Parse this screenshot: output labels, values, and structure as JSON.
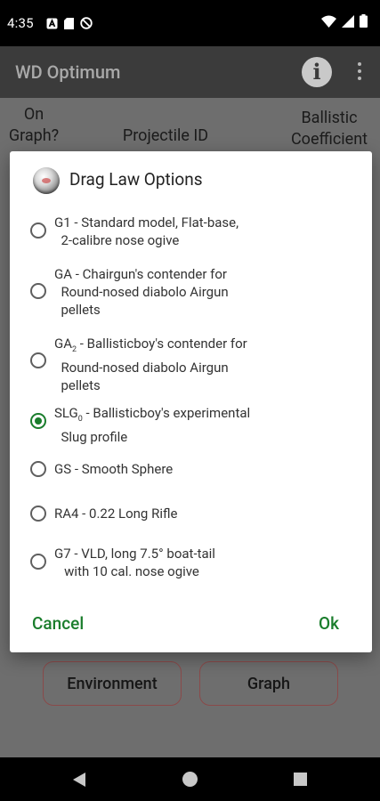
{
  "status_bar": {
    "time": "4:35"
  },
  "app_bar": {
    "title": "WD Optimum"
  },
  "background": {
    "col_on_graph_line1": "On",
    "col_on_graph_line2": "Graph?",
    "col_projectile_id": "Projectile ID",
    "col_bc_line1": "Ballistic",
    "col_bc_line2": "Coefficient",
    "btn_environment": "Environment",
    "btn_graph": "Graph"
  },
  "dialog": {
    "title": "Drag Law Options",
    "options": [
      {
        "line1": "G1 - Standard model, Flat-base,",
        "line2": "  2-calibre nose ogive",
        "line3": "",
        "selected": false
      },
      {
        "line1": "GA - Chairgun's contender for",
        "line2": "  Round-nosed diabolo Airgun",
        "line3": "  pellets",
        "selected": false
      },
      {
        "label_pre": "GA",
        "label_sub": "2",
        "line1_rest": " - Ballisticboy's contender for",
        "line2": "  Round-nosed diabolo Airgun",
        "line3": "  pellets",
        "selected": false
      },
      {
        "label_pre": "SLG",
        "label_sub": "0",
        "line1_rest": " - Ballisticboy's experimental",
        "line2": "  Slug profile",
        "line3": "",
        "selected": true
      },
      {
        "line1": "GS - Smooth Sphere",
        "line2": "",
        "line3": "",
        "selected": false
      },
      {
        "line1": "RA4 - 0.22 Long Rifle",
        "line2": "",
        "line3": "",
        "selected": false
      },
      {
        "line1": "G7 - VLD, long 7.5° boat-tail",
        "line2": "   with 10 cal. nose ogive",
        "line3": "",
        "selected": false
      }
    ],
    "cancel_label": "Cancel",
    "ok_label": "Ok"
  },
  "colors": {
    "accent": "#1a7d2c",
    "scrim": "#6e6e6e",
    "app_bar": "#3b3b3b"
  },
  "icons": [
    "notification-a-icon",
    "sd-card-icon",
    "no-disturb-icon",
    "wifi-icon",
    "signal-icon",
    "battery-icon",
    "info-icon",
    "overflow-menu-icon",
    "bullet-icon",
    "nav-back-icon",
    "nav-home-icon",
    "nav-recents-icon"
  ]
}
